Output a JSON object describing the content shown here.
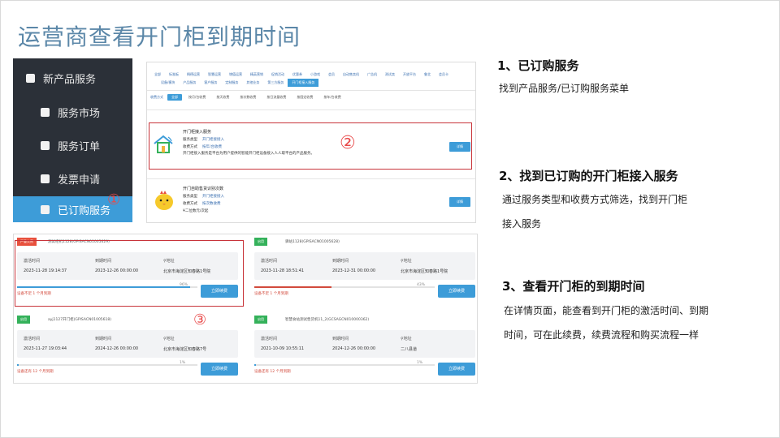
{
  "title": "运营商查看开门柜到期时间",
  "sidebar": {
    "items": [
      {
        "label": "新产品服务"
      },
      {
        "label": "服务市场"
      },
      {
        "label": "服务订单"
      },
      {
        "label": "发票申请"
      },
      {
        "label": "已订购服务"
      }
    ]
  },
  "markers": {
    "one": "①",
    "two": "②",
    "three": "③"
  },
  "services_panel": {
    "tab_row1": [
      "全部",
      "标准板",
      "稠德运营",
      "智慧运营",
      "增值运营",
      "精英营销",
      "促销活动",
      "优惠券",
      "小游戏",
      "会员",
      "自动售卖机",
      "广告机",
      "测试卖",
      "开放平台",
      "鲁北",
      "会员卡"
    ],
    "tab_row2": [
      "设备/模块",
      "产品服务",
      "客户服务",
      "定制服务",
      "其他业务",
      "第三方服务",
      "开门柜接入服务"
    ],
    "tab_row2_selected": "开门柜接入服务",
    "filter_label": "收费方式",
    "filters": [
      "全部",
      "按月/台收费",
      "按天收费",
      "按次数收费",
      "按日流量收费",
      "按固定收费",
      "按年/台收费"
    ],
    "filter_selected": "全部",
    "service1": {
      "name": "开门柜接入服务",
      "type_label": "服务类型",
      "type_value": "开门柜接接入",
      "fee_label": "收费方式",
      "fee_value": "按年/台收费",
      "desc": "开门柜接入服务是平台为用户提供的智能开门柜设备接入人人取平台的产品服务。",
      "button": "详情"
    },
    "service2": {
      "name": "开门自助售货识别次数",
      "type_label": "服务类型",
      "type_value": "开门柜接接入",
      "fee_label": "收费方式",
      "fee_value": "按次数收费",
      "desc": "¥二位数元/次起",
      "button": "详情"
    }
  },
  "devices": {
    "headers": {
      "activation": "激活时间",
      "expiry": "到期时间",
      "address": "地址"
    },
    "renew_label": "立即续费",
    "list": [
      {
        "status": "严重欠费",
        "name": "测试柜机1128(GPISACN01005629)",
        "activation": "2023-11-28 19:14:37",
        "expiry": "2023-12-26 00:00:00",
        "address": "北京市海淀区知春路1号院",
        "progress": 0.96,
        "progress_label": "96%",
        "footer": "设备不足 1 个月到期",
        "bar_color": "#3d9cd8"
      },
      {
        "status": "启用",
        "name": "驿站1128(GPISACN01005628)",
        "activation": "2023-11-28 18:51:41",
        "expiry": "2023-12-31 00:00:00",
        "address": "北京市海淀区知春路1号院",
        "progress": 0.43,
        "progress_label": "43%",
        "footer": "设备不足 1 个月到期",
        "bar_color": "#d24a3c"
      },
      {
        "status": "启用",
        "name": "ayj1127开门柜(GPISACN01005618)",
        "activation": "2023-11-27 19:03:44",
        "expiry": "2024-12-26 00:00:00",
        "address": "北京市海淀区知春路7号",
        "progress": 0.01,
        "progress_label": "1%",
        "footer": "设备还有 12 个月到期",
        "bar_color": "#3d9cd8"
      },
      {
        "status": "启用",
        "name": "智慧食站测试售货机11_2(GCSAGCN010000362)",
        "activation": "2021-10-09 10:55:11",
        "expiry": "2024-12-26 00:00:00",
        "address": "二八县道",
        "progress": 0.01,
        "progress_label": "1%",
        "footer": "设备还有 12 个月到期",
        "bar_color": "#3d9cd8"
      }
    ]
  },
  "steps": [
    {
      "heading": "1、已订购服务",
      "lines": [
        "找到产品服务/已订购服务菜单"
      ]
    },
    {
      "heading": "2、找到已订购的开门柜接入服务",
      "lines": [
        "通过服务类型和收费方式筛选，找到开门柜",
        "接入服务"
      ]
    },
    {
      "heading": "3、查看开门柜的到期时间",
      "lines": [
        "在详情页面，能查看到开门柜的激活时间、到期",
        "时间，可在此续费，续费流程和购买流程一样"
      ]
    }
  ],
  "colors": {
    "accent": "#3d9cd8",
    "title": "#5b87a8",
    "highlight": "#c8343a",
    "sidebar": "#2b3038"
  }
}
